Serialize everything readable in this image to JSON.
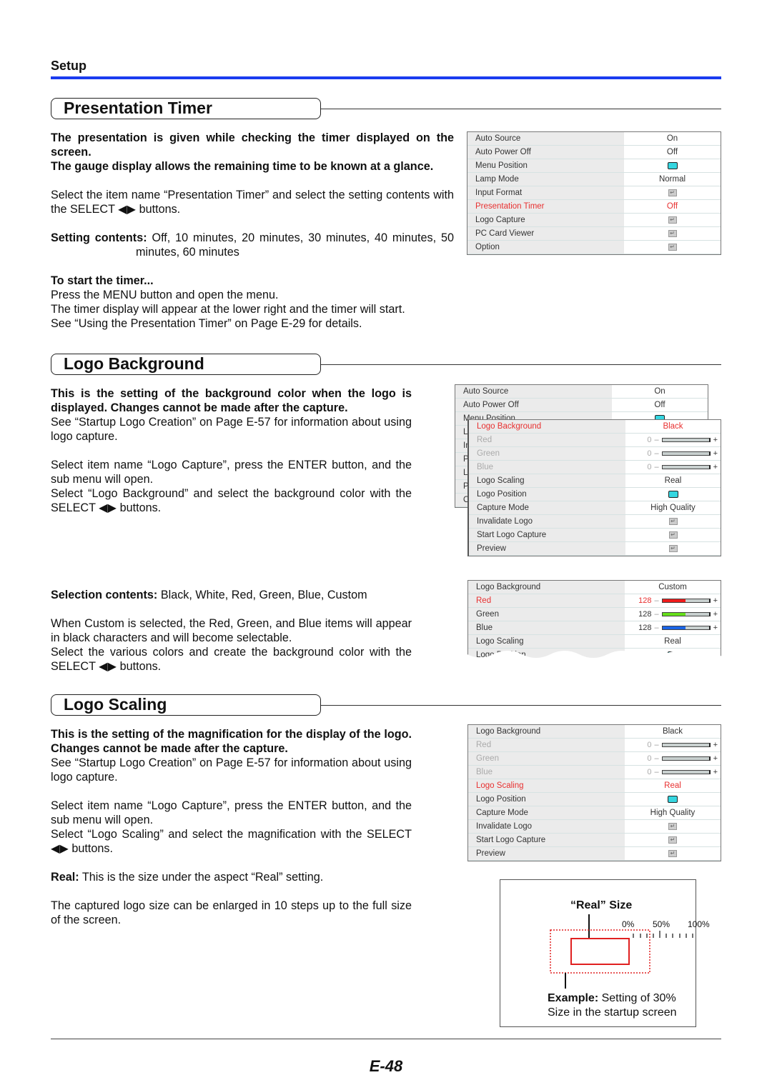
{
  "header": {
    "section": "Setup"
  },
  "presentation_timer": {
    "title": "Presentation Timer",
    "intro1": "The presentation is given while checking the timer displayed on the screen.",
    "intro2": "The gauge display allows the remaining time to be known at a glance.",
    "p1": "Select the item name “Presentation Timer” and select the setting contents with the SELECT ◀▶ buttons.",
    "setting_label": "Setting contents:",
    "setting_values": "Off, 10 minutes, 20 minutes, 30 minutes, 40 minutes, 50 minutes, 60 minutes",
    "start_heading": "To start the timer...",
    "start1": "Press the MENU button and open the menu.",
    "start2": "The timer display will appear at the lower right and the timer will start.",
    "start3": "See “Using the Presentation Timer” on Page E-29 for details.",
    "menu": [
      {
        "label": "Auto Source",
        "value": "On"
      },
      {
        "label": "Auto Power Off",
        "value": "Off"
      },
      {
        "label": "Menu Position",
        "icon": "position-icon"
      },
      {
        "label": "Lamp Mode",
        "value": "Normal"
      },
      {
        "label": "Input Format",
        "icon": "enter-icon"
      },
      {
        "label": "Presentation Timer",
        "value": "Off",
        "state": "hl"
      },
      {
        "label": "Logo Capture",
        "icon": "enter-icon"
      },
      {
        "label": "PC Card Viewer",
        "icon": "enter-icon"
      },
      {
        "label": "Option",
        "icon": "enter-icon"
      }
    ]
  },
  "logo_background": {
    "title": "Logo Background",
    "intro": "This is the setting of the background color when the logo is displayed. Changes cannot be made after the capture.",
    "p1": "See “Startup Logo Creation” on Page E-57 for information about using logo capture.",
    "p2": "Select item name “Logo Capture”, press the ENTER button, and the sub menu will open.",
    "p3": "Select “Logo Background” and select the background color with the SELECT ◀▶ buttons.",
    "selection_label": "Selection contents:",
    "selection_values": "Black, White, Red, Green, Blue, Custom",
    "p4": "When Custom is selected, the Red, Green, and Blue items will appear in black characters and will become selectable.",
    "p5": "Select the various colors and create the background color with the SELECT ◀▶ buttons.",
    "back_menu": [
      {
        "label": "Auto Source",
        "value": "On"
      },
      {
        "label": "Auto Power Off",
        "value": "Off"
      },
      {
        "label": "Menu Position",
        "icon": "position-icon"
      },
      {
        "label": "Lamp Mode",
        "value": ""
      },
      {
        "label": "Input Format",
        "value": ""
      },
      {
        "label": "Presentation Timer",
        "value": ""
      },
      {
        "label": "Logo Capture",
        "value": ""
      },
      {
        "label": "PC Card Viewer",
        "value": ""
      },
      {
        "label": "Option",
        "value": ""
      }
    ],
    "menu": [
      {
        "label": "Logo Background",
        "value": "Black",
        "state": "hl"
      },
      {
        "label": "Red",
        "slider": {
          "value": "0",
          "fill": 0,
          "color": "#e02020"
        },
        "state": "dim"
      },
      {
        "label": "Green",
        "slider": {
          "value": "0",
          "fill": 0,
          "color": "#60e020"
        },
        "state": "dim"
      },
      {
        "label": "Blue",
        "slider": {
          "value": "0",
          "fill": 0,
          "color": "#1060e0"
        },
        "state": "dim"
      },
      {
        "label": "Logo Scaling",
        "value": "Real"
      },
      {
        "label": "Logo Position",
        "icon": "position-icon"
      },
      {
        "label": "Capture Mode",
        "value": "High Quality"
      },
      {
        "label": "Invalidate Logo",
        "icon": "enter-icon"
      },
      {
        "label": "Start Logo Capture",
        "icon": "enter-icon"
      },
      {
        "label": "Preview",
        "icon": "enter-icon"
      }
    ],
    "custom_menu": [
      {
        "label": "Logo Background",
        "value": "Custom"
      },
      {
        "label": "Red",
        "slider": {
          "value": "128",
          "fill": 0.5,
          "color": "#ee1c1c"
        },
        "state": "hl"
      },
      {
        "label": "Green",
        "slider": {
          "value": "128",
          "fill": 0.5,
          "color": "#66e01a"
        }
      },
      {
        "label": "Blue",
        "slider": {
          "value": "128",
          "fill": 0.5,
          "color": "#1a64e6"
        }
      },
      {
        "label": "Logo Scaling",
        "value": "Real"
      },
      {
        "label": "Logo Position",
        "icon": "position-icon"
      }
    ]
  },
  "logo_scaling": {
    "title": "Logo Scaling",
    "intro": "This is the setting of the magnification for the display of the logo. Changes cannot be made after the capture.",
    "p1": "See “Startup Logo Creation” on Page E-57 for information about using logo capture.",
    "p2": "Select item name “Logo Capture”, press the ENTER button, and the sub menu will open.",
    "p3": "Select “Logo Scaling” and select the magnification with the SELECT ◀▶ buttons.",
    "real_label": "Real:",
    "real_text": "This is the size under the aspect “Real” setting.",
    "p4": "The captured logo size can be enlarged in 10 steps up to the full size of the screen.",
    "menu": [
      {
        "label": "Logo Background",
        "value": "Black"
      },
      {
        "label": "Red",
        "slider": {
          "value": "0",
          "fill": 0,
          "color": "#e02020"
        },
        "state": "dim"
      },
      {
        "label": "Green",
        "slider": {
          "value": "0",
          "fill": 0,
          "color": "#60e020"
        },
        "state": "dim"
      },
      {
        "label": "Blue",
        "slider": {
          "value": "0",
          "fill": 0,
          "color": "#1060e0"
        },
        "state": "dim"
      },
      {
        "label": "Logo Scaling",
        "value": "Real",
        "state": "hl"
      },
      {
        "label": "Logo Position",
        "icon": "position-icon"
      },
      {
        "label": "Capture Mode",
        "value": "High Quality"
      },
      {
        "label": "Invalidate Logo",
        "icon": "enter-icon"
      },
      {
        "label": "Start Logo Capture",
        "icon": "enter-icon"
      },
      {
        "label": "Preview",
        "icon": "enter-icon"
      }
    ],
    "diagram": {
      "title": "“Real” Size",
      "tick0": "0%",
      "tick50": "50%",
      "tick100": "100%",
      "example_label": "Example:",
      "example_text": "Setting of 30%",
      "example_line2": "Size in the startup screen",
      "accent": "#e02020"
    }
  },
  "footer": {
    "page": "E-48"
  }
}
